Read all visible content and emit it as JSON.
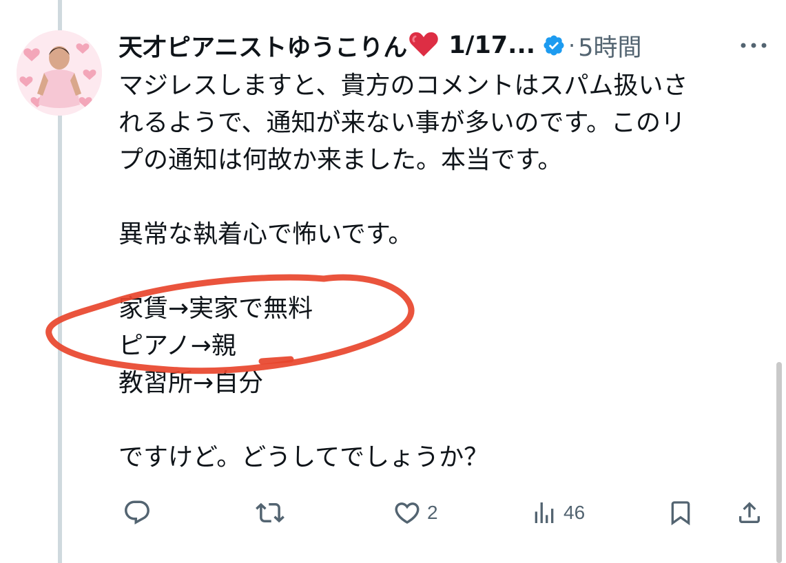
{
  "tweet": {
    "display_name": "天才ピアニストゆうこりん",
    "name_emoji": "❤️",
    "handle_truncated": "1/17...",
    "separator": "·",
    "time_ago": "5時間",
    "body_lines": [
      "マジレスしますと、貴方のコメントはスパム扱いさ",
      "れるようで、通知が来ない事が多いのです。このリ",
      "プの通知は何故か来ました。本当です。",
      "",
      "異常な執着心で怖いです。",
      "",
      "家賃→実家で無料",
      "ピアノ→親",
      "教習所→自分",
      "",
      "ですけど。どうしてでしょうか？"
    ]
  },
  "actions": {
    "reply_count": "",
    "retweet_count": "",
    "like_count": "2",
    "views_count": "46"
  },
  "icons": {
    "more": "more-horizontal-icon",
    "verified": "verified-badge-icon",
    "reply": "reply-icon",
    "retweet": "retweet-icon",
    "like": "heart-icon",
    "views": "views-bar-chart-icon",
    "bookmark": "bookmark-icon",
    "share": "share-icon"
  },
  "colors": {
    "text": "#0f1419",
    "muted": "#536471",
    "verified": "#1d9bf0",
    "annotation": "#e8452c",
    "thread_line": "#cfd9de"
  }
}
